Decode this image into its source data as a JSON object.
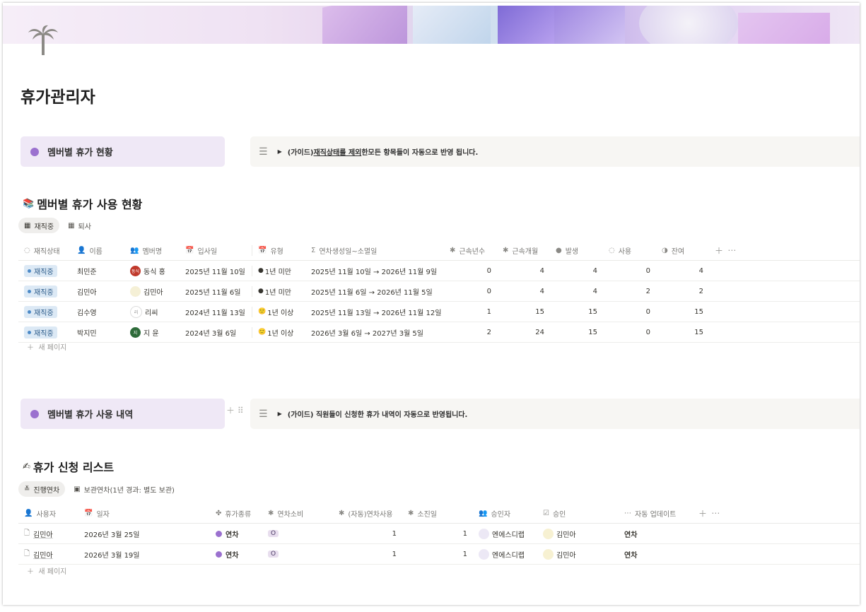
{
  "page": {
    "title": "휴가관리자"
  },
  "section1": {
    "callout_label": "멤버별 휴가 현황",
    "guide_prefix": "(가이드) ",
    "guide_underlined": "재직상태를 제외",
    "guide_suffix": "한모든 항목들이 자동으로 반영 됩니다.",
    "heading": "멤버별 휴가 사용 현황",
    "tabs": [
      {
        "label": "재직중"
      },
      {
        "label": "퇴사"
      }
    ],
    "columns": [
      "재직상태",
      "이름",
      "멤버명",
      "입사일",
      "유형",
      "연차생성일~소멸일",
      "근속년수",
      "근속개월",
      "발생",
      "사용",
      "잔여"
    ],
    "rows": [
      {
        "status": "재직중",
        "name": "최민준",
        "member": "동식 홍",
        "avatar_text": "동식",
        "avatar_color": "#c0392b",
        "join": "2025년 11월 10일",
        "type_icon": "●",
        "type": "1년 미만",
        "period": "2025년 11월 10일 → 2026년 11월 9일",
        "years": "0",
        "months": "4",
        "gen": "4",
        "used": "0",
        "left": "4"
      },
      {
        "status": "재직중",
        "name": "김민아",
        "member": "김민아",
        "avatar_text": "",
        "avatar_color": "#f5f0d6",
        "join": "2025년 11월 6일",
        "type_icon": "●",
        "type": "1년 미만",
        "period": "2025년 11월 6일 → 2026년 11월 5일",
        "years": "0",
        "months": "4",
        "gen": "4",
        "used": "2",
        "left": "2"
      },
      {
        "status": "재직중",
        "name": "김수영",
        "member": "리씨",
        "avatar_text": "리",
        "avatar_color": "#ffffff",
        "join": "2024년 11월 13일",
        "type_icon": "🙂",
        "type": "1년 이상",
        "period": "2025년 11월 13일 → 2026년 11월 12일",
        "years": "1",
        "months": "15",
        "gen": "15",
        "used": "0",
        "left": "15"
      },
      {
        "status": "재직중",
        "name": "박지민",
        "member": "지 윤",
        "avatar_text": "지",
        "avatar_color": "#2e6b3a",
        "join": "2024년 3월 6일",
        "type_icon": "🙂",
        "type": "1년 이상",
        "period": "2026년 3월 6일 → 2027년 3월 5일",
        "years": "2",
        "months": "24",
        "gen": "15",
        "used": "0",
        "left": "15"
      }
    ],
    "new_page": "새 페이지"
  },
  "section2": {
    "callout_label": "멤버별 휴가 사용 내역",
    "guide": "(가이드) 직원들이 신청한 휴가 내역이 자동으로 반영됩니다.",
    "heading": "휴가 신청 리스트",
    "tabs": [
      {
        "label": "진행연차"
      },
      {
        "label": "보관연차(1년 경과: 별도 보관)"
      }
    ],
    "columns": [
      "사용자",
      "일자",
      "휴가종류",
      "연차소비",
      "(자동)연차사용",
      "소진일",
      "승인자",
      "승인",
      "자동 업데이트"
    ],
    "rows": [
      {
        "user": "김민아",
        "date": "2026년 3월 25일",
        "kind": "연차",
        "consume": "O",
        "auto_use": "1",
        "days": "1",
        "approver": "엔에스디랩",
        "approved_by": "김민아",
        "auto_update": "연차"
      },
      {
        "user": "김민아",
        "date": "2026년 3월 19일",
        "kind": "연차",
        "consume": "O",
        "auto_use": "1",
        "days": "1",
        "approver": "엔에스디랩",
        "approved_by": "김민아",
        "auto_update": "연차"
      }
    ],
    "new_page": "새 페이지"
  }
}
